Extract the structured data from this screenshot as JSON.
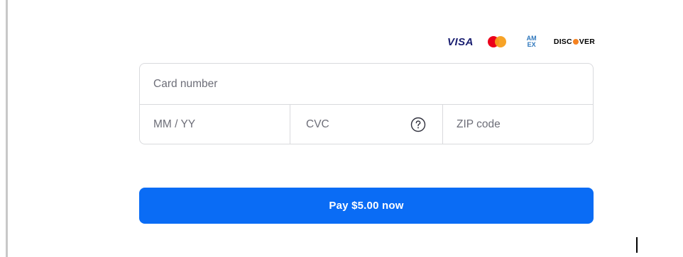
{
  "card_brands": {
    "visa": "VISA",
    "mastercard": "mastercard",
    "amex_top": "AM",
    "amex_bottom": "EX",
    "discover_pre": "DISC",
    "discover_post": "VER"
  },
  "form": {
    "card_number_placeholder": "Card number",
    "expiry_placeholder": "MM / YY",
    "cvc_placeholder": "CVC",
    "zip_placeholder": "ZIP code",
    "cvc_help_icon": "question-circle-icon"
  },
  "pay_button": {
    "label": "Pay $5.00 now"
  },
  "colors": {
    "accent": "#0a6cf5",
    "visa": "#1a1f71",
    "amex": "#2e77bc",
    "discover_orange": "#f58220",
    "border": "#d9dadd",
    "placeholder": "#6d6e78"
  }
}
